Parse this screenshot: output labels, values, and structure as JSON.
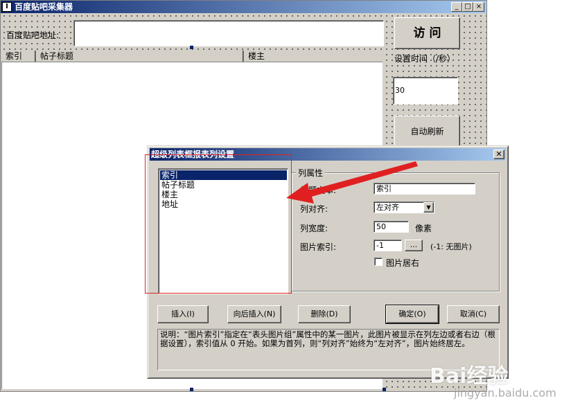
{
  "main_window": {
    "title": "百度贴吧采集器",
    "address_label": "百度贴吧地址:",
    "address_value": "",
    "visit_button": "访 问",
    "interval_label": "设置时间（/秒）",
    "interval_value": "30",
    "auto_refresh_button": "自动刷新",
    "list_columns": [
      "索引",
      "帖子标题",
      "楼主"
    ]
  },
  "dialog": {
    "title": "超级列表框报表列设置",
    "columns": [
      "索引",
      "帖子标题",
      "楼主",
      "地址"
    ],
    "selected_index": 0,
    "group_title": "列属性",
    "title_text_label": "标题文本:",
    "title_text_value": "索引",
    "align_label": "列对齐:",
    "align_value": "左对齐",
    "width_label": "列宽度:",
    "width_value": "50",
    "width_unit": "像素",
    "image_index_label": "图片索引:",
    "image_index_value": "-1",
    "image_browse_button": "...",
    "image_index_hint": "(-1: 无图片)",
    "image_right_label": "图片居右",
    "image_right_checked": false,
    "buttons": {
      "insert": "插入(I)",
      "insert_after": "向后插入(N)",
      "delete": "删除(D)",
      "ok": "确定(O)",
      "cancel": "取消(C)"
    },
    "description": "说明：“图片索引”指定在“表头图片组”属性中的某一图片，此图片被显示在列左边或者右边（根据设置），索引值从 0 开始。如果为首列，则“列对齐”始终为“左对齐”，图片始终居左。"
  },
  "watermark": {
    "logo": "Bai经验",
    "url": "jingyan.baidu.com"
  },
  "colors": {
    "titlebar": "#0a246a",
    "face": "#d4d0c8",
    "annotation": "#e02020"
  }
}
